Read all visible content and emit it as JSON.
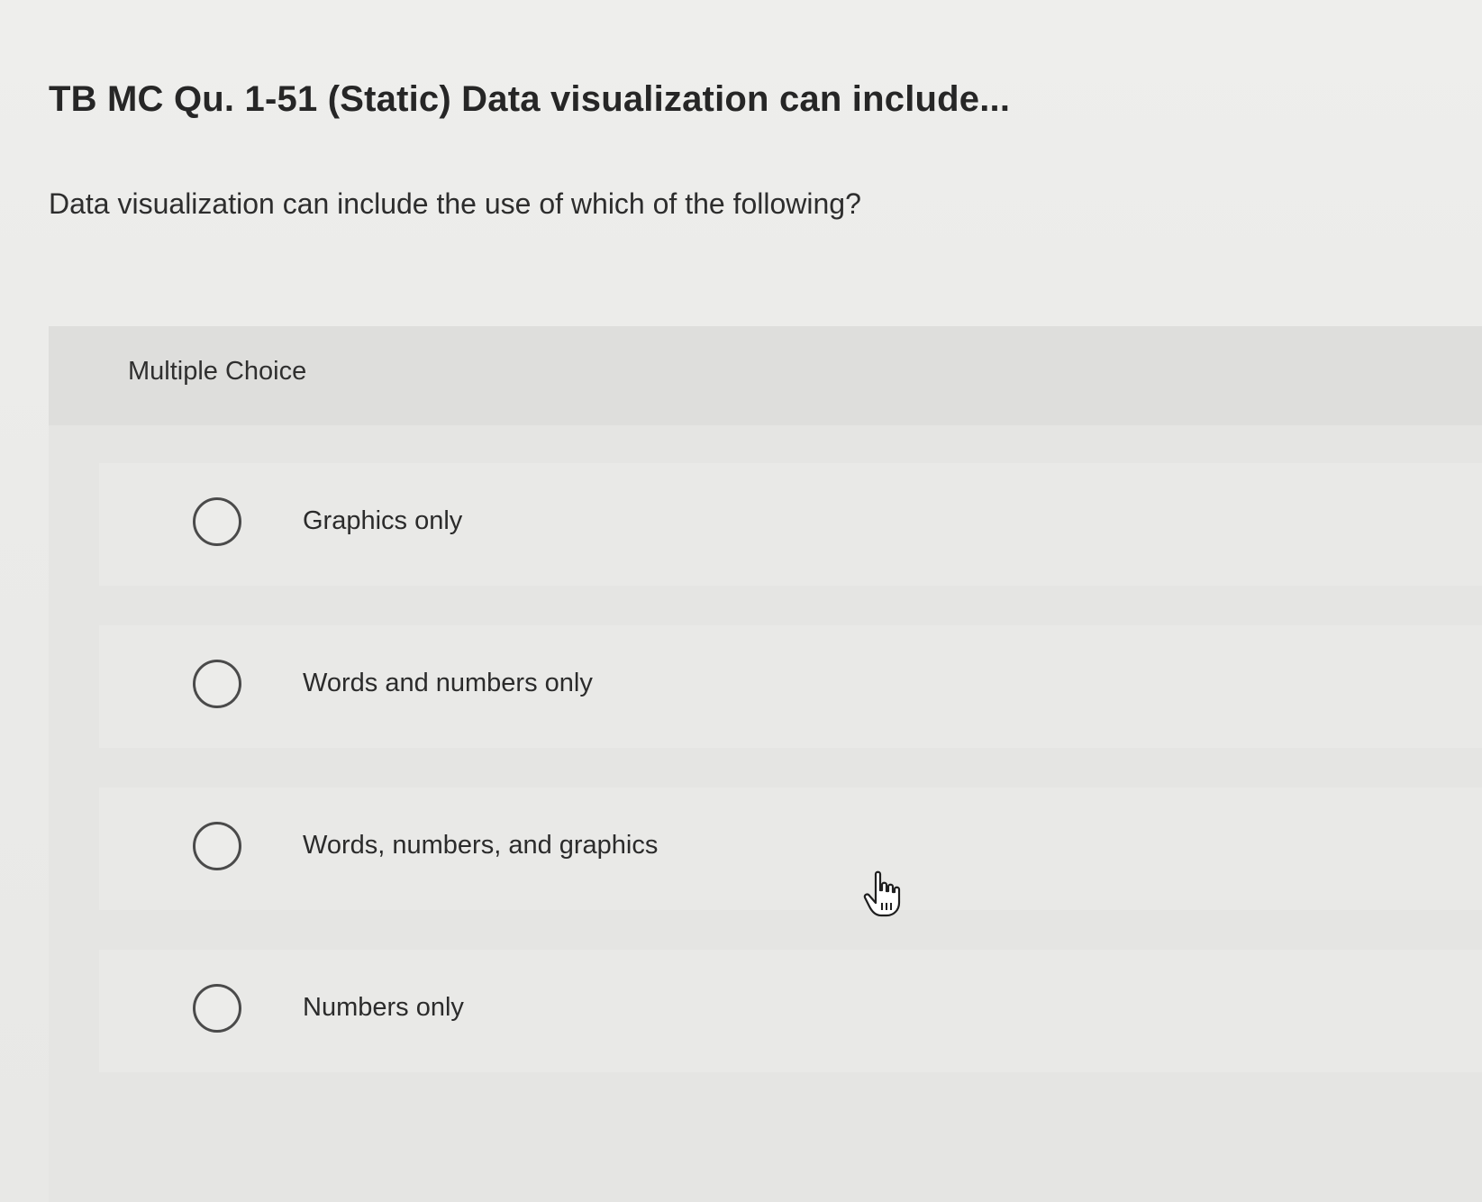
{
  "question": {
    "title": "TB MC Qu. 1-51 (Static) Data visualization can include...",
    "prompt": "Data visualization can include the use of which of the following?"
  },
  "multiple_choice": {
    "label": "Multiple Choice",
    "options": [
      {
        "label": "Graphics only",
        "selected": false
      },
      {
        "label": "Words and numbers only",
        "selected": false
      },
      {
        "label": "Words, numbers, and graphics",
        "selected": false
      },
      {
        "label": "Numbers only",
        "selected": false
      }
    ]
  },
  "cursor": {
    "icon": "hand-pointer-icon"
  },
  "colors": {
    "background": "#ebebea",
    "panel": "#e5e5e3",
    "text": "#2b2b2b",
    "radio_border": "#4a4a4a"
  }
}
